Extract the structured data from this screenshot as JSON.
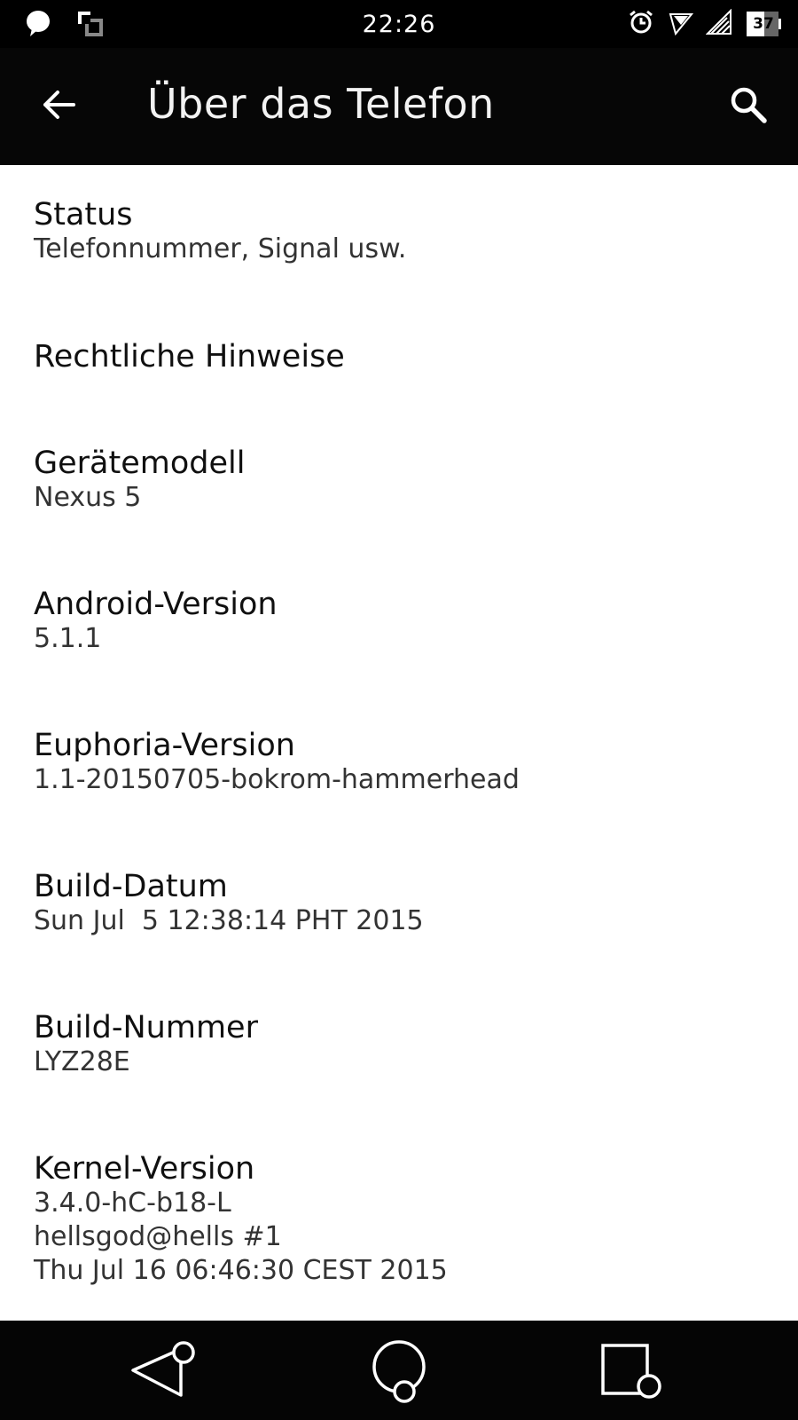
{
  "status_bar": {
    "time": "22:26",
    "battery_level": "37",
    "icons": [
      "chat-bubble-icon",
      "screenshot-icon",
      "alarm-icon",
      "wifi-icon",
      "cell-signal-icon",
      "battery-icon"
    ]
  },
  "app_bar": {
    "title": "Über das Telefon",
    "back_icon": "arrow-back-icon",
    "search_icon": "search-icon"
  },
  "items": [
    {
      "title": "Status",
      "subtitle": [
        "Telefonnummer, Signal usw."
      ]
    },
    {
      "title": "Rechtliche Hinweise",
      "subtitle": []
    },
    {
      "title": "Gerätemodell",
      "subtitle": [
        "Nexus 5"
      ]
    },
    {
      "title": "Android-Version",
      "subtitle": [
        "5.1.1"
      ]
    },
    {
      "title": "Euphoria-Version",
      "subtitle": [
        "1.1-20150705-bokrom-hammerhead"
      ]
    },
    {
      "title": "Build-Datum",
      "subtitle": [
        "Sun Jul  5 12:38:14 PHT 2015"
      ]
    },
    {
      "title": "Build-Nummer",
      "subtitle": [
        "LYZ28E"
      ]
    },
    {
      "title": "Kernel-Version",
      "subtitle": [
        "3.4.0-hC-b18-L",
        "hellsgod@hells #1",
        "Thu Jul 16 06:46:30 CEST 2015"
      ]
    }
  ],
  "nav_bar": {
    "icons": [
      "nav-back-icon",
      "nav-home-icon",
      "nav-recents-icon"
    ]
  },
  "colors": {
    "bar_background": "#060606",
    "content_background": "#ffffff",
    "title_text": "#101010",
    "subtitle_text": "#333333"
  }
}
